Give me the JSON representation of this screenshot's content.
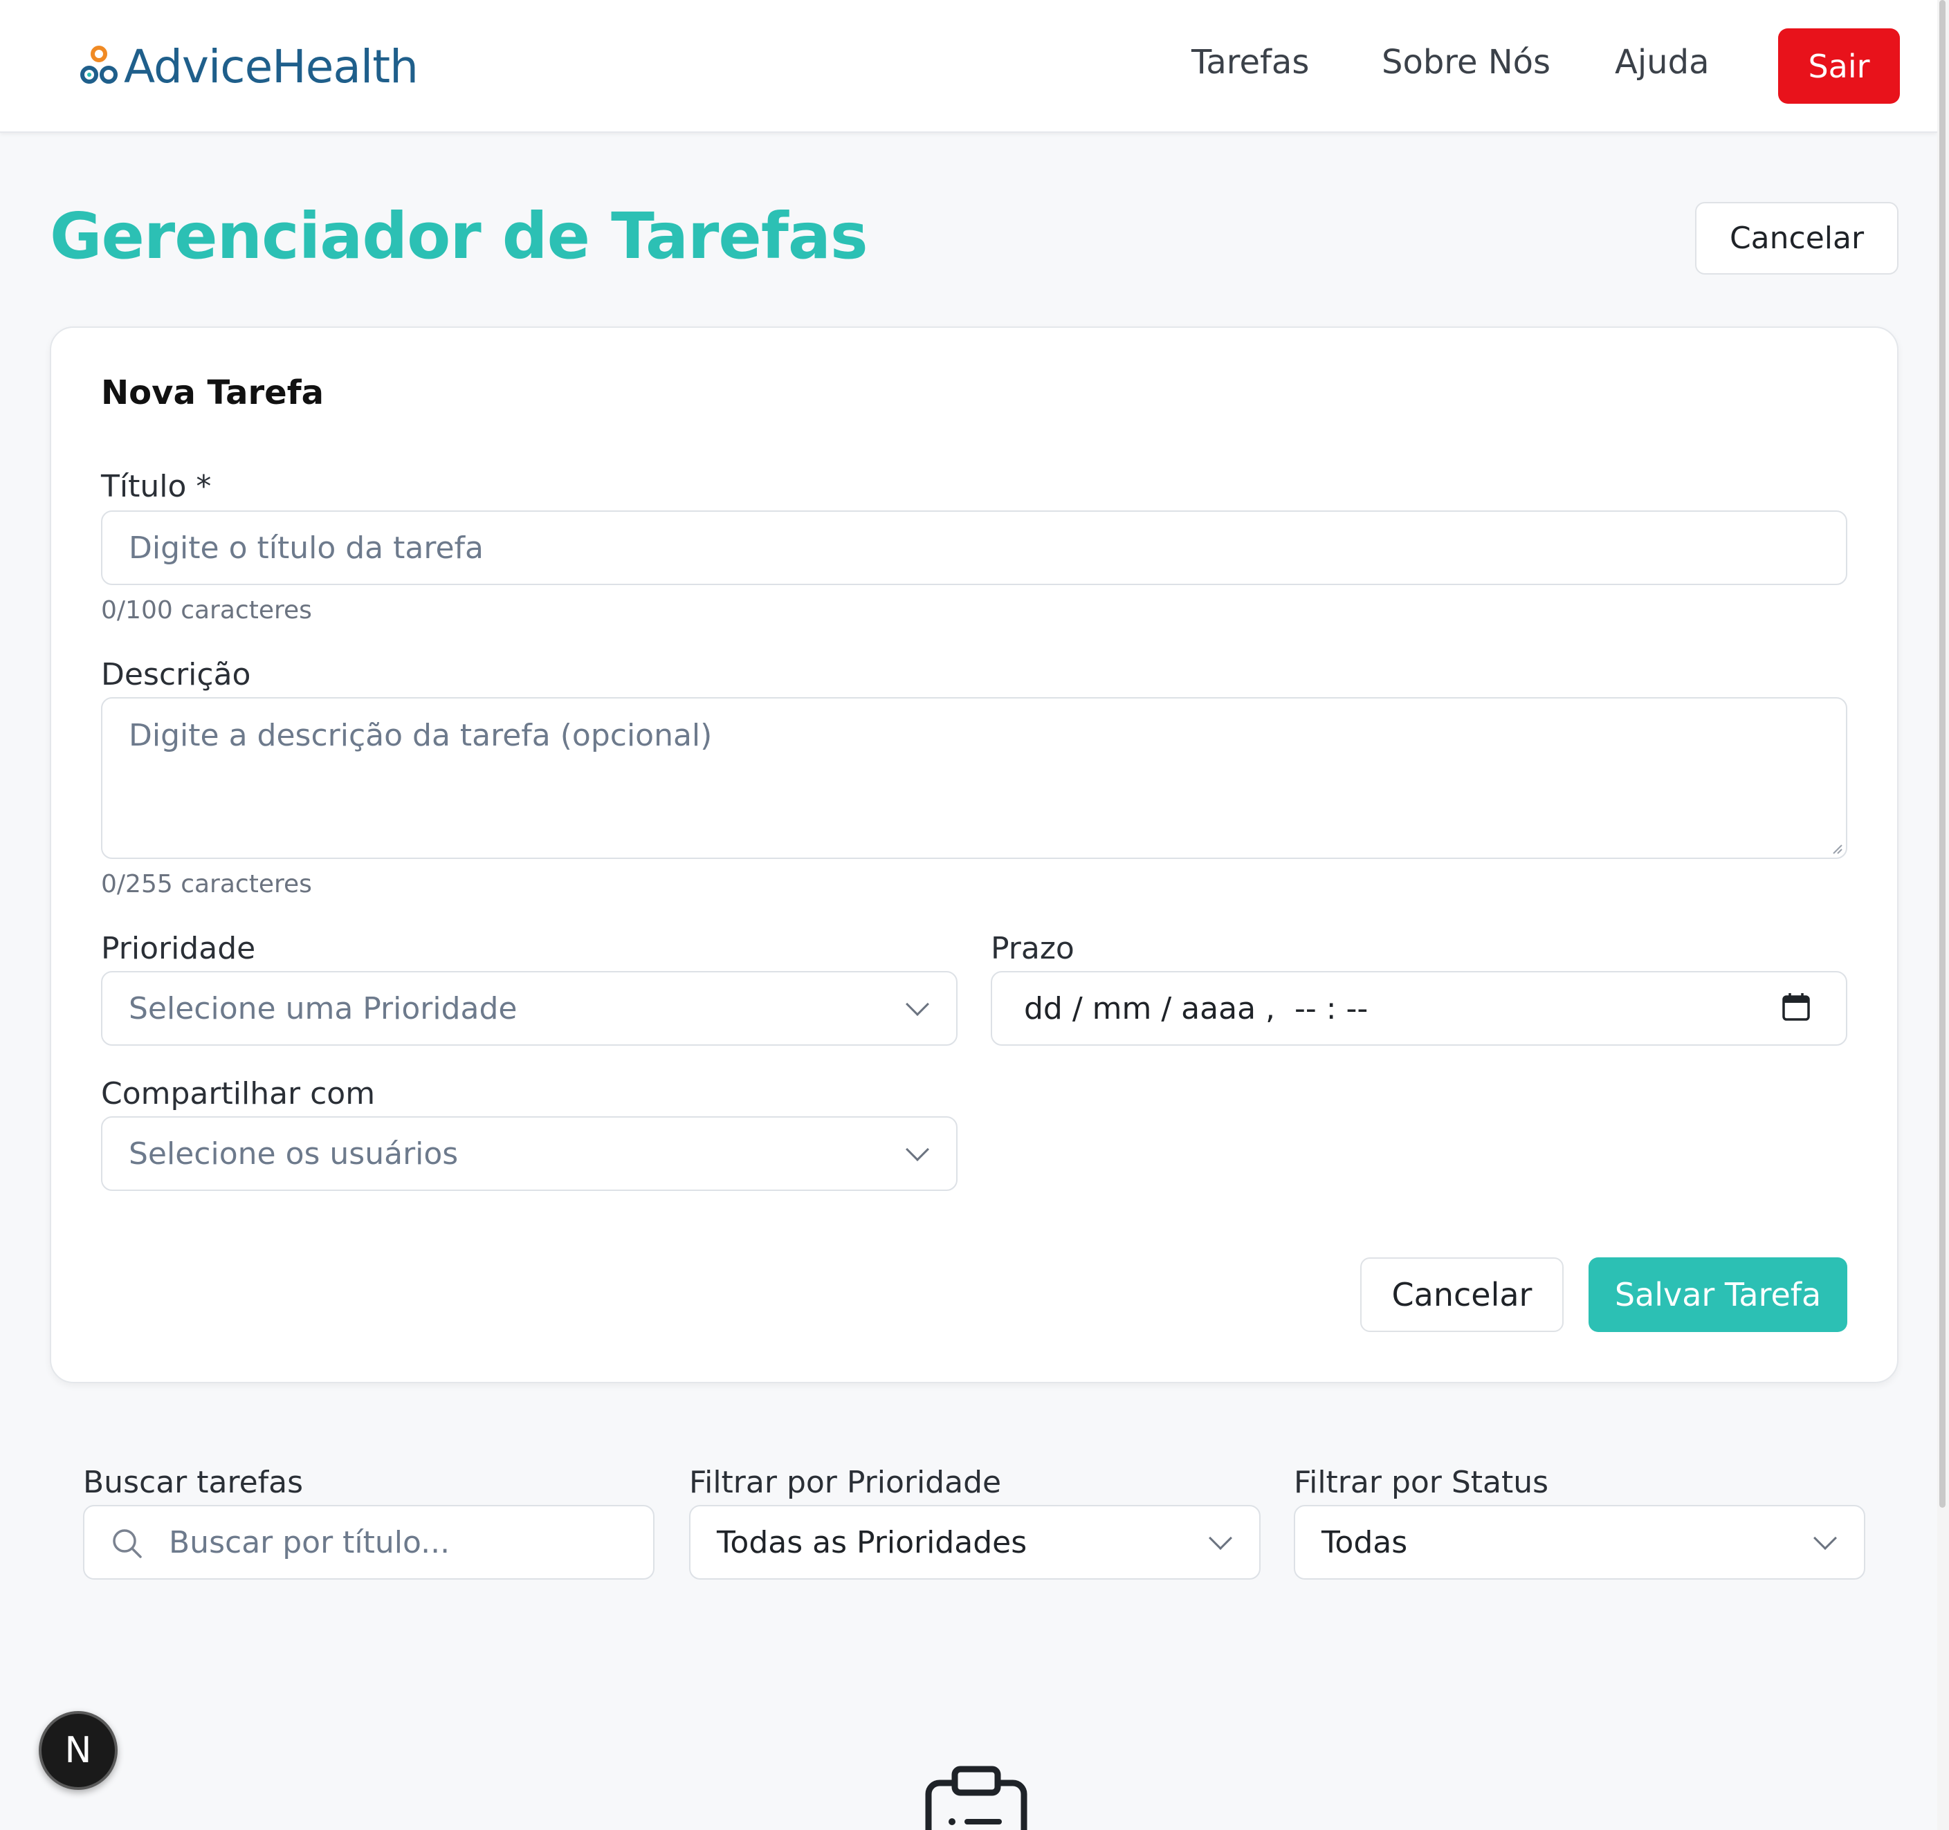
{
  "header": {
    "brand": "AdviceHealth",
    "nav": {
      "tarefas": "Tarefas",
      "sobre": "Sobre Nós",
      "ajuda": "Ajuda"
    },
    "logout_label": "Sair"
  },
  "main": {
    "title": "Gerenciador de Tarefas",
    "cancel_label": "Cancelar"
  },
  "form": {
    "heading": "Nova Tarefa",
    "title_label": "Título *",
    "title_placeholder": "Digite o título da tarefa",
    "title_counter": "0/100 caracteres",
    "description_label": "Descrição",
    "description_placeholder": "Digite a descrição da tarefa (opcional)",
    "description_counter": "0/255 caracteres",
    "priority_label": "Prioridade",
    "priority_placeholder": "Selecione uma Prioridade",
    "deadline_label": "Prazo",
    "deadline_value": "dd / mm / aaaa ,  -- : --",
    "share_label": "Compartilhar com",
    "share_placeholder": "Selecione os usuários",
    "cancel_label": "Cancelar",
    "save_label": "Salvar Tarefa"
  },
  "filters": {
    "search_label": "Buscar tarefas",
    "search_placeholder": "Buscar por título...",
    "priority_label": "Filtrar por Prioridade",
    "priority_value": "Todas as Prioridades",
    "status_label": "Filtrar por Status",
    "status_value": "Todas"
  },
  "badge": {
    "letter": "N"
  },
  "colors": {
    "accent": "#2cc0b4",
    "danger": "#e8121b",
    "brand": "#1f5f8b"
  },
  "icons": [
    "logo-icon",
    "chevron-down-icon",
    "calendar-icon",
    "search-icon",
    "clipboard-icon"
  ]
}
